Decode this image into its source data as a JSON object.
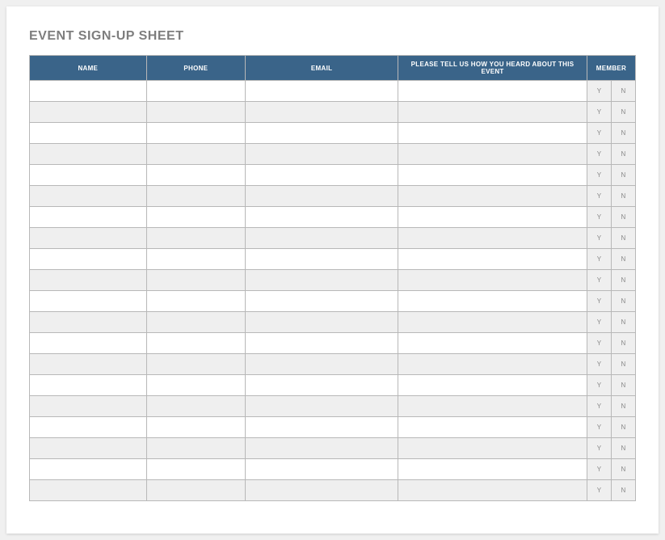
{
  "title": "EVENT SIGN-UP SHEET",
  "columns": {
    "name": "NAME",
    "phone": "PHONE",
    "email": "EMAIL",
    "heard": "PLEASE TELL US HOW YOU HEARD ABOUT THIS EVENT",
    "member": "MEMBER"
  },
  "yn": {
    "y": "Y",
    "n": "N"
  },
  "row_count": 20
}
